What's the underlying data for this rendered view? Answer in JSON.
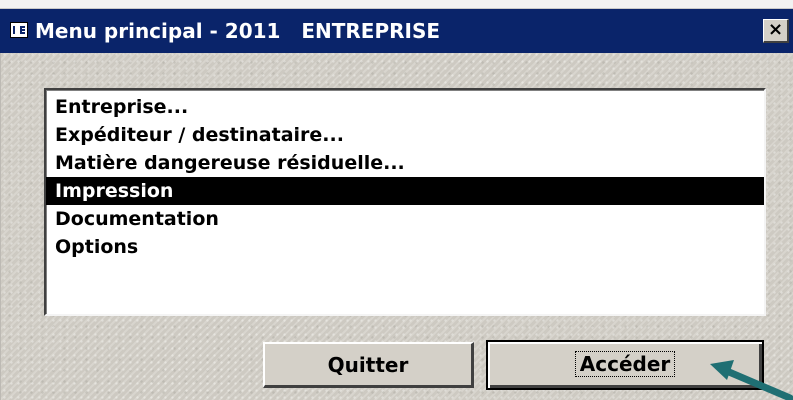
{
  "window": {
    "title": "Menu principal - 2011   ENTREPRISE",
    "close_label": "×"
  },
  "menu": {
    "items": [
      {
        "label": "Entreprise...",
        "selected": false
      },
      {
        "label": "Expéditeur / destinataire...",
        "selected": false
      },
      {
        "label": "Matière dangereuse résiduelle...",
        "selected": false
      },
      {
        "label": "Impression",
        "selected": true
      },
      {
        "label": "Documentation",
        "selected": false
      },
      {
        "label": "Options",
        "selected": false
      }
    ]
  },
  "buttons": {
    "quit_label": "Quitter",
    "access_label": "Accéder"
  },
  "colors": {
    "titlebar": "#0a246a",
    "window_face": "#d4d0c8",
    "selection": "#000000",
    "annotation_arrow": "#1f6f73"
  },
  "icons": {
    "title": "form-window-icon",
    "close": "close-icon",
    "annotation": "pointer-arrow-icon"
  }
}
